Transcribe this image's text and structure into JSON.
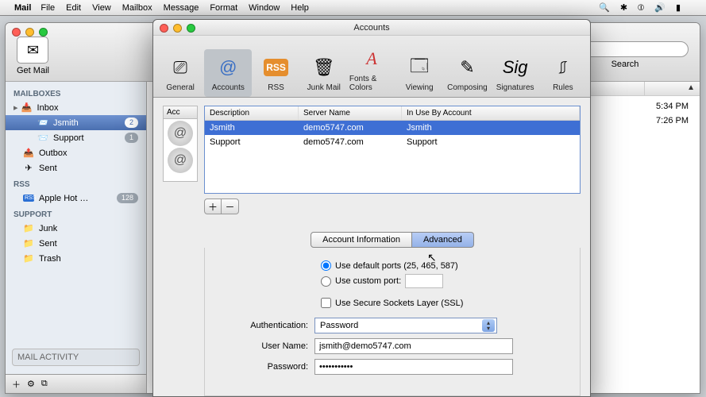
{
  "menubar": {
    "app": "Mail",
    "items": [
      "File",
      "Edit",
      "View",
      "Mailbox",
      "Message",
      "Format",
      "Window",
      "Help"
    ]
  },
  "mailwin": {
    "getmail_label": "Get Mail",
    "search_label": "Search",
    "sidebar": {
      "mailboxes_hdr": "MAILBOXES",
      "inbox": "Inbox",
      "jsmith": "Jsmith",
      "jsmith_badge": "2",
      "support": "Support",
      "support_badge": "1",
      "outbox": "Outbox",
      "sent": "Sent",
      "rss_hdr": "RSS",
      "apple_hot": "Apple Hot …",
      "apple_hot_badge": "128",
      "support_hdr": "SUPPORT",
      "junk": "Junk",
      "sent2": "Sent",
      "trash": "Trash",
      "activity": "MAIL ACTIVITY"
    },
    "times": {
      "t1": "5:34 PM",
      "t2": "7:26 PM"
    }
  },
  "pref": {
    "title": "Accounts",
    "tabs": {
      "general": "General",
      "accounts": "Accounts",
      "rss": "RSS",
      "junk": "Junk Mail",
      "fonts": "Fonts & Colors",
      "viewing": "Viewing",
      "composing": "Composing",
      "signatures": "Signatures",
      "rules": "Rules"
    },
    "acc_hdr": "Acc",
    "table": {
      "cols": {
        "desc": "Description",
        "server": "Server Name",
        "inuse": "In Use By Account"
      },
      "rows": [
        {
          "desc": "Jsmith",
          "server": "demo5747.com",
          "inuse": "Jsmith"
        },
        {
          "desc": "Support",
          "server": "demo5747.com",
          "inuse": "Support"
        }
      ]
    },
    "seg": {
      "info": "Account Information",
      "adv": "Advanced"
    },
    "form": {
      "default_ports": "Use default ports (25, 465, 587)",
      "custom_port": "Use custom port:",
      "ssl": "Use Secure Sockets Layer (SSL)",
      "auth_label": "Authentication:",
      "auth_value": "Password",
      "user_label": "User Name:",
      "user_value": "jsmith@demo5747.com",
      "pass_label": "Password:",
      "pass_value": "•••••••••••"
    }
  }
}
